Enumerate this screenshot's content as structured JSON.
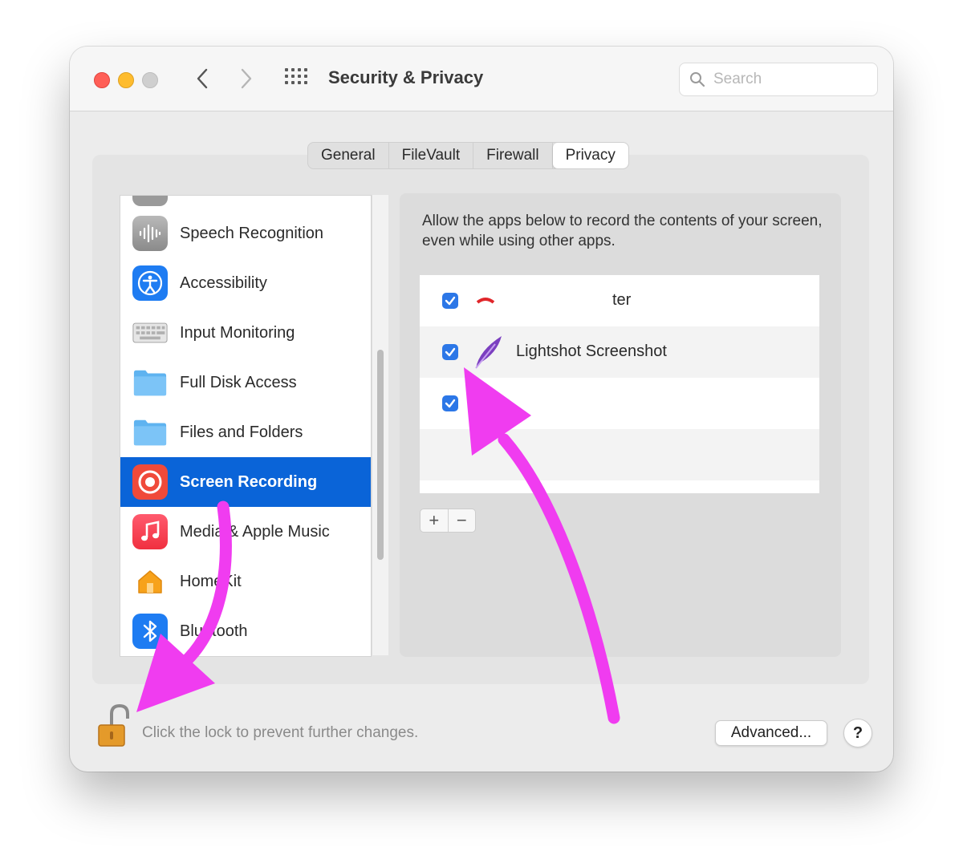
{
  "window": {
    "title": "Security & Privacy",
    "search_placeholder": "Search"
  },
  "tabs": [
    {
      "label": "General",
      "active": false
    },
    {
      "label": "FileVault",
      "active": false
    },
    {
      "label": "Firewall",
      "active": false
    },
    {
      "label": "Privacy",
      "active": true
    }
  ],
  "sidebar": {
    "items": [
      {
        "label": "Speech Recognition",
        "icon": "waveform-icon"
      },
      {
        "label": "Accessibility",
        "icon": "accessibility-icon"
      },
      {
        "label": "Input Monitoring",
        "icon": "keyboard-icon"
      },
      {
        "label": "Full Disk Access",
        "icon": "folder-icon"
      },
      {
        "label": "Files and Folders",
        "icon": "folder-icon"
      },
      {
        "label": "Screen Recording",
        "icon": "screen-recording-icon",
        "selected": true
      },
      {
        "label": "Media & Apple Music",
        "icon": "music-note-icon"
      },
      {
        "label": "HomeKit",
        "icon": "home-icon"
      },
      {
        "label": "Bluetooth",
        "icon": "bluetooth-icon"
      }
    ]
  },
  "main": {
    "description": "Allow the apps below to record the contents of your screen, even while using other apps.",
    "apps": [
      {
        "name": "ter",
        "checked": true
      },
      {
        "name": "Lightshot Screenshot",
        "checked": true,
        "icon": "feather-icon"
      },
      {
        "name": "",
        "checked": true
      }
    ],
    "add_label": "+",
    "remove_label": "−"
  },
  "footer": {
    "lock_text": "Click the lock to prevent further changes.",
    "advanced_label": "Advanced...",
    "help_label": "?"
  },
  "colors": {
    "selection": "#0a64d8",
    "checkbox": "#2c77e7",
    "annotation_arrow": "#f03cf0"
  }
}
